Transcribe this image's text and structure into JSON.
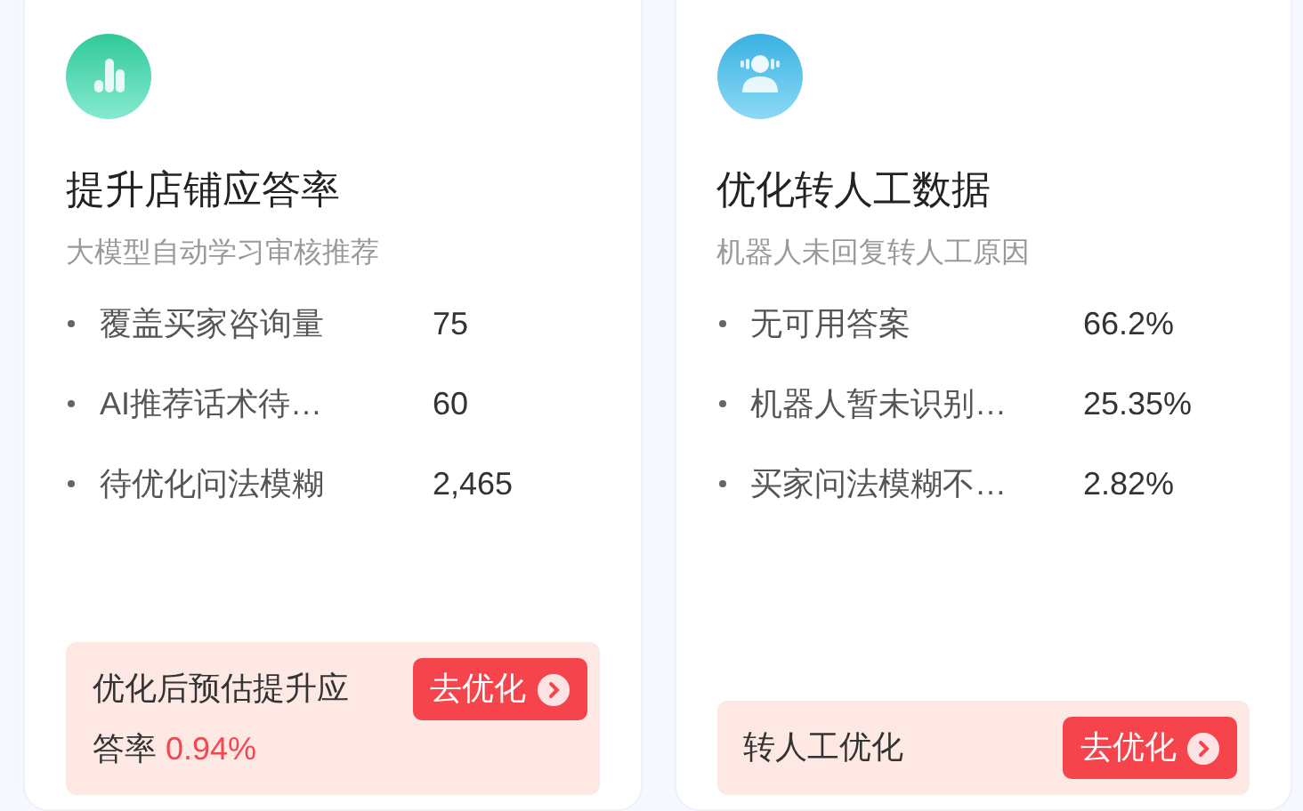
{
  "cards": [
    {
      "kind": "bars",
      "title": "提升店铺应答率",
      "subtitle": "大模型自动学习审核推荐",
      "rows": [
        {
          "label": "覆盖买家咨询量",
          "value": "75"
        },
        {
          "label": "AI推荐话术待…",
          "value": "60"
        },
        {
          "label": "待优化问法模糊",
          "value": "2,465"
        }
      ],
      "footer": {
        "text": "优化后预估提升应答率",
        "highlight": "0.94%",
        "button": "去优化"
      }
    },
    {
      "kind": "agent",
      "title": "优化转人工数据",
      "subtitle": "机器人未回复转人工原因",
      "rows": [
        {
          "label": "无可用答案",
          "value": "66.2%"
        },
        {
          "label": "机器人暂未识别…",
          "value": "25.35%"
        },
        {
          "label": "买家问法模糊不…",
          "value": "2.82%"
        }
      ],
      "footer": {
        "text": "转人工优化",
        "button": "去优化"
      }
    }
  ]
}
